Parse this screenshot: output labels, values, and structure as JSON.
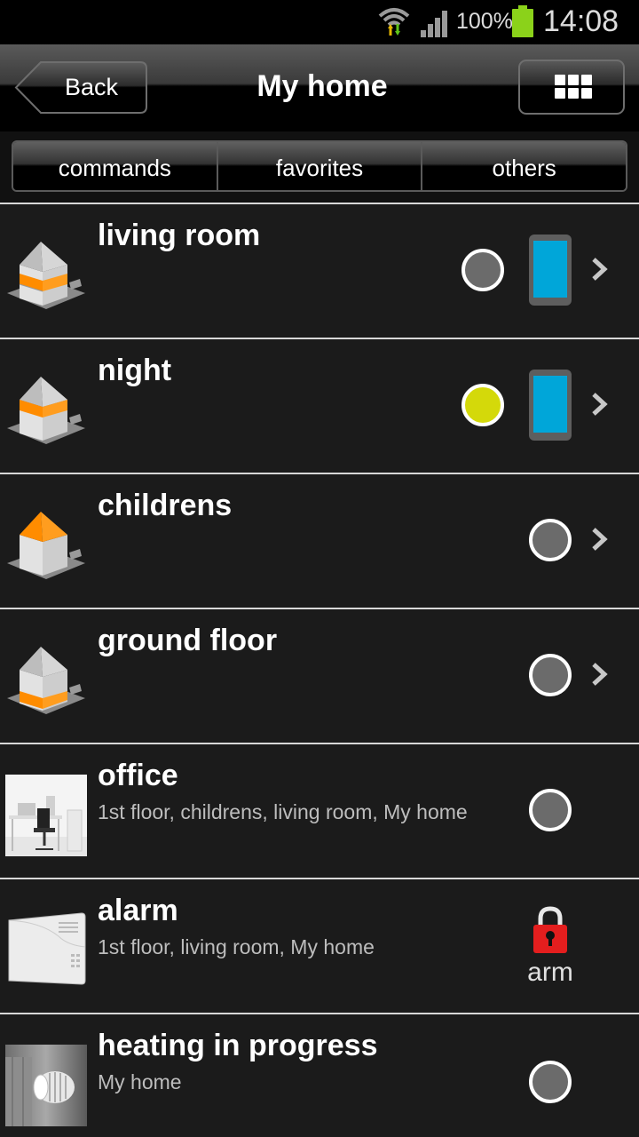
{
  "status_bar": {
    "battery_percent": "100%",
    "time": "14:08",
    "icons": [
      "wifi-icon",
      "signal-icon",
      "battery-icon"
    ]
  },
  "action_bar": {
    "back_label": "Back",
    "title": "My home",
    "grid_icon": "grid-menu-icon"
  },
  "tabs": [
    {
      "label": "commands"
    },
    {
      "label": "favorites"
    },
    {
      "label": "others"
    }
  ],
  "list": {
    "rows": [
      {
        "name": "living room",
        "subtitle": "",
        "thumb": "house-icon",
        "status": "off",
        "has_phone": true,
        "chevron": true
      },
      {
        "name": "night",
        "subtitle": "",
        "thumb": "house-icon",
        "status": "on",
        "has_phone": true,
        "chevron": true
      },
      {
        "name": "childrens",
        "subtitle": "",
        "thumb": "house-icon",
        "status": "off",
        "has_phone": false,
        "chevron": true
      },
      {
        "name": "ground floor",
        "subtitle": "",
        "thumb": "house-icon",
        "status": "off",
        "has_phone": false,
        "chevron": true
      },
      {
        "name": "office",
        "subtitle": "1st floor, childrens, living room, My home",
        "thumb": "office-photo",
        "status": "off",
        "has_phone": false,
        "chevron": false
      },
      {
        "name": "alarm",
        "subtitle": "1st floor, living room, My home",
        "thumb": "alarm-device-photo",
        "action_label": "arm",
        "action_icon": "lock-icon"
      },
      {
        "name": "heating in progress",
        "subtitle": "My home",
        "thumb": "radiator-valve-photo",
        "status": "off",
        "has_phone": false,
        "chevron": false
      }
    ]
  },
  "colors": {
    "indicator_on": "#d4d90a",
    "indicator_off": "#6b6b6b",
    "phone_screen": "#00a6d9",
    "house_accent": "#ff8c00",
    "lock": "#e41e1e",
    "battery": "#8bd21a"
  }
}
